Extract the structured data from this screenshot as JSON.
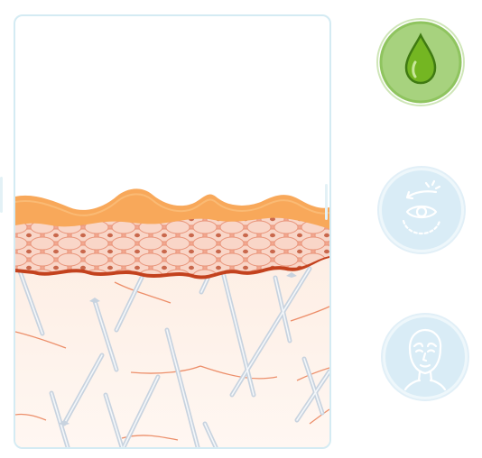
{
  "colors": {
    "panel_border": "#d4ebf3",
    "surface_orange": "#f8a85a",
    "cell_fill": "#f8d0c0",
    "cell_nucleus": "#c9684c",
    "base_brown": "#c3421e",
    "dermis_bg": "#fef4ee",
    "fiber": "#c8d3df",
    "vessel": "#e8764a",
    "active_green": "#a7d27e",
    "inactive_blue": "#d9ecf6"
  },
  "panels": {
    "skin_diagram": {
      "icon": "skin-cross-section"
    }
  },
  "buttons": [
    {
      "id": "hydration",
      "icon": "water-drop-icon",
      "state": "active"
    },
    {
      "id": "eye",
      "icon": "eye-lift-icon",
      "state": "inactive"
    },
    {
      "id": "face",
      "icon": "face-icon",
      "state": "inactive"
    }
  ]
}
